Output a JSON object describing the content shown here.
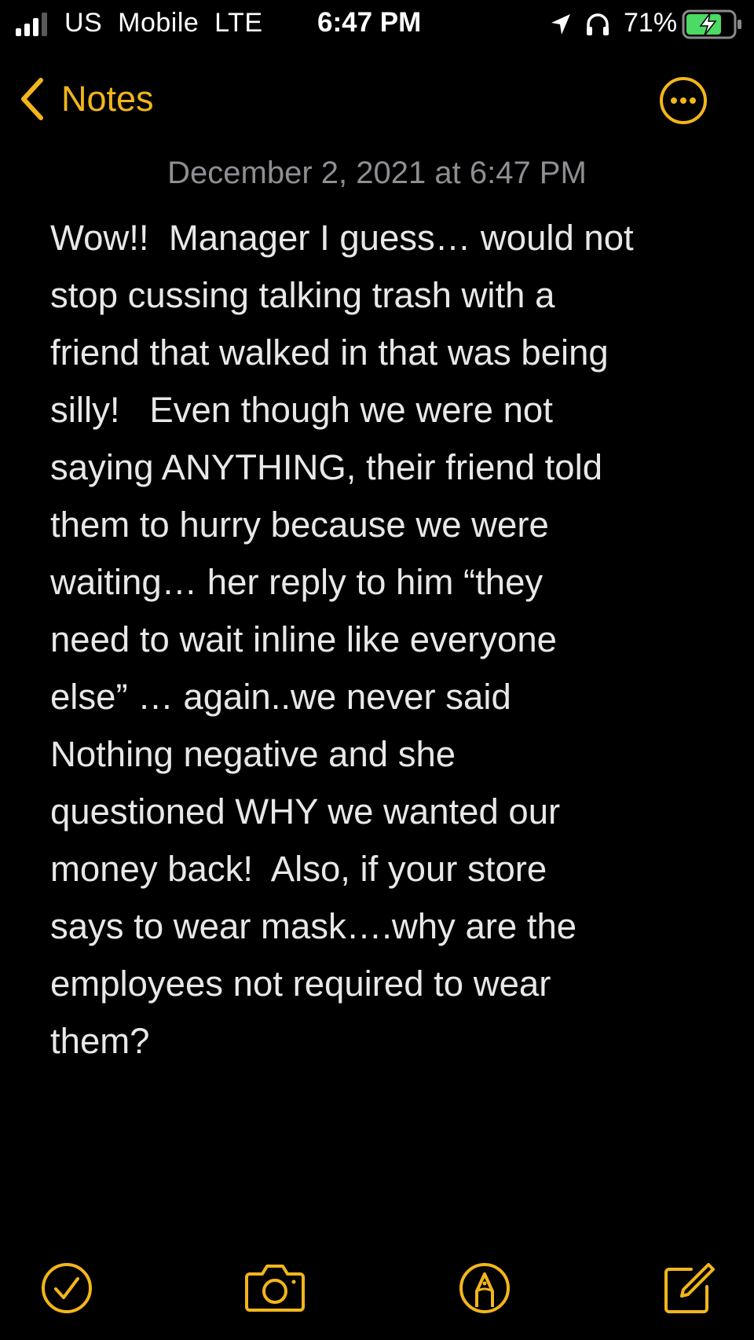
{
  "status_bar": {
    "carrier": "US  Mobile  LTE",
    "time": "6:47 PM",
    "battery": "71%"
  },
  "nav": {
    "back_label": "Notes"
  },
  "note": {
    "timestamp": "December 2, 2021 at 6:47 PM",
    "body": "Wow!!  Manager I guess… would not\nstop cussing talking trash with a\nfriend that walked in that was being\nsilly!   Even though we were not\nsaying ANYTHING, their friend told\nthem to hurry because we were\nwaiting… her reply to him “they\nneed to wait inline like everyone\nelse” … again..we never said\nNothing negative and she\nquestioned WHY we wanted our\nmoney back!  Also, if your store\nsays to wear mask….why are the\nemployees not required to wear\nthem?"
  },
  "icons": {
    "back": "chevron-left-icon",
    "more": "ellipsis-circle-icon",
    "checklist": "checkmark-circle-icon",
    "camera": "camera-icon",
    "markup": "markup-pen-icon",
    "compose": "compose-icon"
  },
  "colors": {
    "accent": "#f2b61b",
    "background": "#000000",
    "text": "#e8e8e8",
    "timestamp": "#8e8e93",
    "battery_charging": "#4cd964"
  }
}
